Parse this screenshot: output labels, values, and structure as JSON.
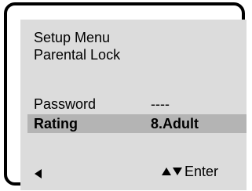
{
  "menu": {
    "title": "Setup Menu",
    "subtitle": "Parental Lock"
  },
  "rows": [
    {
      "label": "Password",
      "value": "----"
    },
    {
      "label": "Rating",
      "value": "8.Adult",
      "selected": true
    }
  ],
  "footer": {
    "back_icon": "left-triangle",
    "up_icon": "up-triangle",
    "down_icon": "down-triangle",
    "enter_label": "Enter"
  },
  "colors": {
    "screen_bg": "#dcdcdc",
    "selected_row_bg": "#b4b4b4",
    "bezel": "#000000"
  }
}
